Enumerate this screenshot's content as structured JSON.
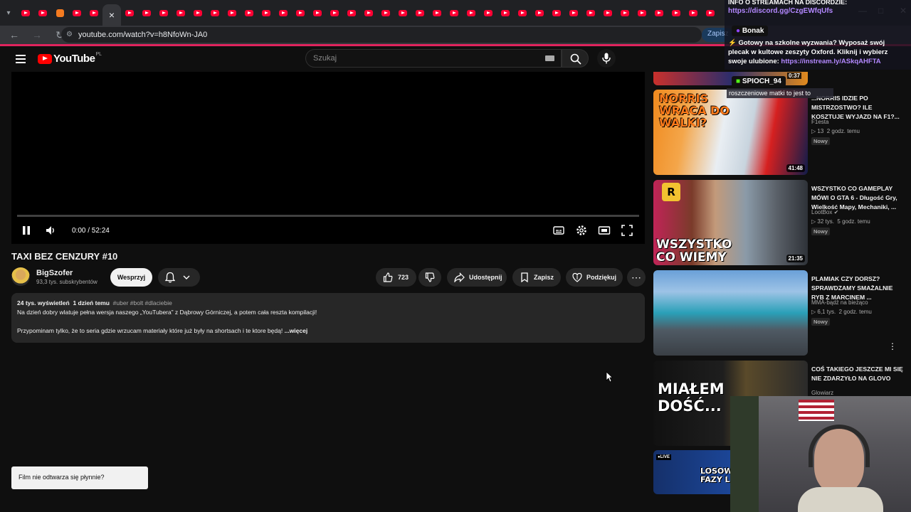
{
  "browser": {
    "tab_count": 41,
    "url": "youtube.com/watch?v=h8NfoWn-JA0",
    "zapisz_chip": "Zapisz"
  },
  "header": {
    "logo": "YouTube",
    "region": "PL",
    "search_placeholder": "Szukaj"
  },
  "player": {
    "time": "0:00 / 52:24"
  },
  "video": {
    "title": "TAXI BEZ CENZURY #10",
    "channel": "BigSzofer",
    "subscribers": "93,3 tys. subskrybentów",
    "support_label": "Wesprzyj",
    "likes": "723",
    "share_label": "Udostępnij",
    "save_label": "Zapisz",
    "thanks_label": "Podziękuj",
    "description": {
      "views": "24 tys. wyświetleń",
      "date": "1 dzień temu",
      "tags": "#uber #bolt #dlaciebie",
      "line1": "Na dzień dobry wlatuje pełna wersja naszego „YouTubera” z Dąbrowy Górniczej, a potem cała reszta kompilacji!",
      "line2": "Przypominam tylko, że to seria gdzie wrzucam materiały które już były na shortsach i te ktore będą!",
      "more": "...więcej"
    }
  },
  "toast": "Film nie odtwarza się płynnie?",
  "sidebar": [
    {
      "title": "...NORRIS IDZIE PO MISTRZOSTWO? ILE KOSZTUJE WYJAZD NA F1?...",
      "channel": "F1esta",
      "views": "13",
      "age": "2 godz. temu",
      "badge": "Nowy",
      "duration": "41:48",
      "thumb_text": "NORRIS WRACA DO WALKI?"
    },
    {
      "title": "WSZYSTKO CO GAMEPLAY MÓWI O GTA 6 - Długość Gry, Wielkość Mapy, Mechaniki, ...",
      "channel": "LootBox",
      "views": "32 tys.",
      "age": "5 godz. temu",
      "badge": "Nowy",
      "duration": "21:35",
      "thumb_text": "WSZYSTKO CO WIEMY"
    },
    {
      "title": "PLAMIAK CZY DORSZ? SPRAWDZAMY SMAŻALNIE RYB Z MARCINEM ...",
      "channel": "MMA-bądź na bieżąco",
      "views": "6,1 tys.",
      "age": "2 godz. temu",
      "badge": "Nowy",
      "duration": "",
      "thumb_text": ""
    },
    {
      "title": "COŚ TAKIEGO JESZCZE MI SIĘ NIE ZDARZYŁO NA GLOVO",
      "channel": "Glowiarz",
      "views": "",
      "age": "",
      "badge": "",
      "duration": "",
      "thumb_text": "MIAŁEM DOŚĆ..."
    },
    {
      "title": "",
      "channel": "",
      "views": "",
      "age": "",
      "badge": "",
      "duration": "",
      "thumb_text": "LOSOW FAZY L"
    }
  ],
  "overlay": {
    "line1": "INFO O STREAMACH NA DISCORDZIE:",
    "link1": "https://discord.gg/CzgEWfqUfs",
    "user1": "Bonak",
    "message": "⚡ Gotowy na szkolne wyzwania? Wyposaż swój plecak w kultowe zeszyty Oxford. Kliknij i wybierz swoje ulubione:",
    "message_link": "https://instream.ly/ASkqAHFTA",
    "user2": "SPIOCH_94",
    "chat2": "roszczeniowe matki to jest to",
    "gain": "0:37"
  },
  "colors": {
    "bg": "#0f0f0f",
    "accent": "#ff0033"
  }
}
